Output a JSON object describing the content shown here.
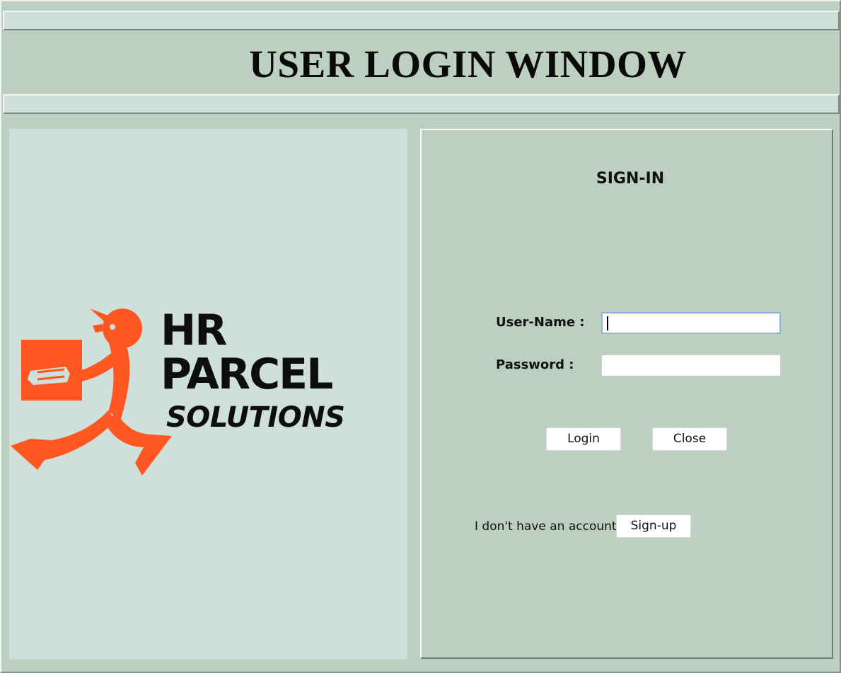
{
  "window": {
    "title": "USER LOGIN WINDOW"
  },
  "logo": {
    "line1": "HR",
    "line2": "PARCEL",
    "line3": "SOLUTIONS",
    "accent_color": "#ff5722"
  },
  "signin": {
    "heading": "SIGN-IN",
    "username_label": "User-Name :",
    "username_value": "",
    "password_label": "Password :",
    "password_value": "",
    "login_label": "Login",
    "close_label": "Close",
    "no_account_text": "I don't have an account",
    "signup_label": "Sign-up"
  },
  "colors": {
    "background": "#bdcfc1",
    "panel": "#cfdfdb",
    "focus_border": "#8fb3e0"
  }
}
